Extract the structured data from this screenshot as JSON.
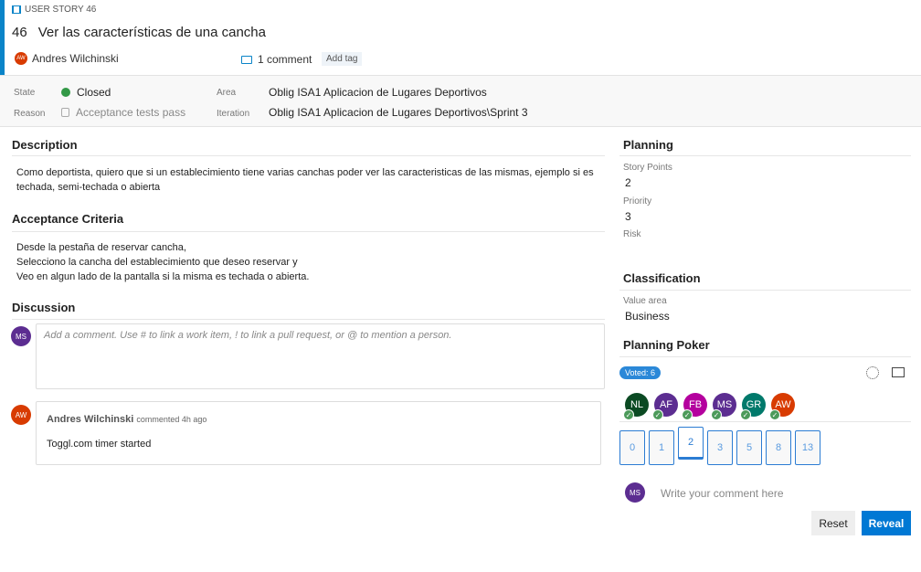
{
  "header": {
    "type_label": "USER STORY 46",
    "id": "46",
    "title": "Ver las características de una cancha",
    "assignee": {
      "initials": "AW",
      "name": "Andres Wilchinski"
    },
    "comments": "1 comment",
    "add_tag": "Add tag"
  },
  "fields": {
    "state_label": "State",
    "state": "Closed",
    "reason_label": "Reason",
    "reason": "Acceptance tests pass",
    "area_label": "Area",
    "area": "Oblig ISA1 Aplicacion de Lugares Deportivos",
    "iteration_label": "Iteration",
    "iteration": "Oblig ISA1 Aplicacion de Lugares Deportivos\\Sprint 3"
  },
  "description": {
    "title": "Description",
    "text": "Como deportista, quiero que si un establecimiento tiene varias canchas poder ver las caracteristicas de las mismas, ejemplo si es techada, semi-techada o abierta"
  },
  "acceptance": {
    "title": "Acceptance Criteria",
    "lines": [
      "Desde la pestaña de reservar cancha,",
      "Selecciono la cancha del establecimiento que deseo reservar y",
      "Veo en algun lado de la pantalla si la misma es techada o abierta."
    ]
  },
  "discussion": {
    "title": "Discussion",
    "user_initials": "MS",
    "placeholder": "Add a comment. Use # to link a work item, ! to link a pull request, or @ to mention a person.",
    "comment": {
      "initials": "AW",
      "author": "Andres Wilchinski",
      "meta": "commented 4h ago",
      "text": "Toggl.com timer started"
    }
  },
  "planning": {
    "title": "Planning",
    "story_points_label": "Story Points",
    "story_points": "2",
    "priority_label": "Priority",
    "priority": "3",
    "risk_label": "Risk"
  },
  "classification": {
    "title": "Classification",
    "value_area_label": "Value area",
    "value_area": "Business"
  },
  "poker": {
    "title": "Planning Poker",
    "voted": "Voted: 6",
    "voters": [
      {
        "i": "NL",
        "c": "#0b4a23"
      },
      {
        "i": "AF",
        "c": "#5c2d91"
      },
      {
        "i": "FB",
        "c": "#b4009e"
      },
      {
        "i": "MS",
        "c": "#5c2d91"
      },
      {
        "i": "GR",
        "c": "#00796b"
      },
      {
        "i": "AW",
        "c": "#d83b01"
      }
    ],
    "cards": [
      "0",
      "1",
      "2",
      "3",
      "5",
      "8",
      "13"
    ],
    "selected": "2",
    "user_initials": "MS",
    "comment_placeholder": "Write your comment here",
    "reset": "Reset",
    "reveal": "Reveal"
  },
  "colors": {
    "accent": "#0078d4",
    "closed": "#339947"
  }
}
